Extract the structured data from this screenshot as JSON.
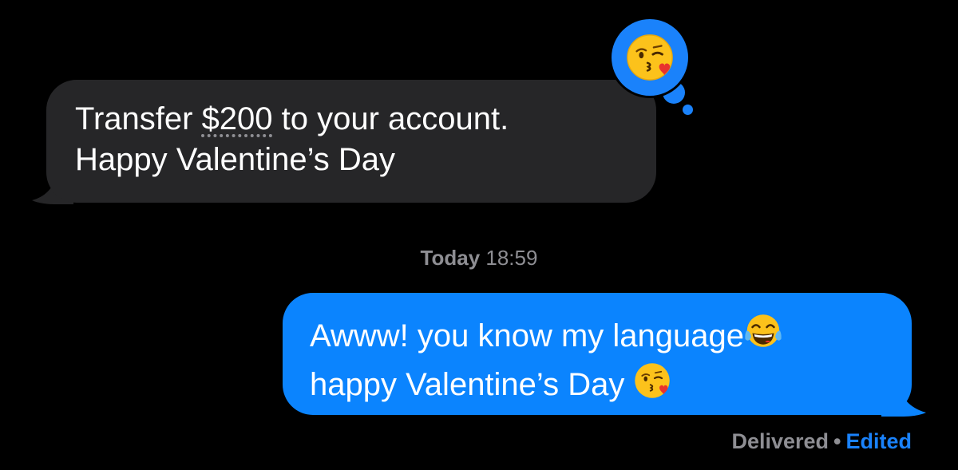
{
  "incoming": {
    "line1_before": "Transfer ",
    "amount": "$200",
    "line1_after": " to your account.",
    "line2": "Happy Valentine’s Day"
  },
  "tapback": {
    "icon": "face-blowing-kiss-icon"
  },
  "timestamp": {
    "day": "Today",
    "time": "18:59"
  },
  "outgoing": {
    "line1": "Awww! you know my language",
    "line1_emoji": "face-with-tears-of-joy-icon",
    "line2": "happy Valentine’s Day ",
    "line2_emoji": "face-blowing-kiss-icon"
  },
  "status": {
    "delivered": "Delivered",
    "separator": "•",
    "edited": "Edited"
  },
  "colors": {
    "background": "#000000",
    "incoming_bubble": "#262628",
    "outgoing_bubble": "#0b84fe",
    "accent": "#1a82fb",
    "secondary_text": "#8e8e93"
  }
}
